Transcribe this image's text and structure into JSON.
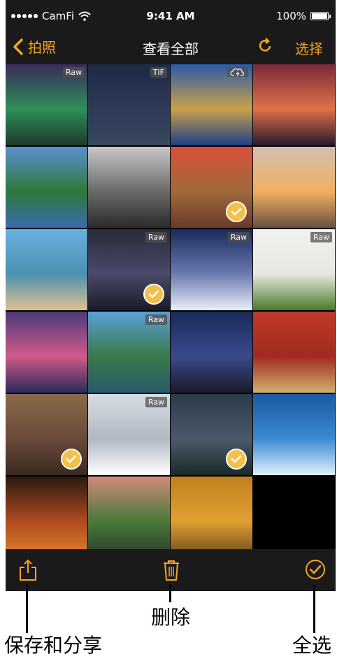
{
  "status_bar": {
    "carrier": "CamFi",
    "time": "9:41 AM",
    "battery": "100%"
  },
  "nav": {
    "back_label": "拍照",
    "title": "查看全部",
    "select_label": "选择"
  },
  "grid": {
    "tiles": [
      {
        "badge": "Raw",
        "check": false,
        "cloud": false,
        "colors": [
          "#3b2a5a",
          "#2f8f5a",
          "#1c3b2a"
        ]
      },
      {
        "badge": "TIF",
        "check": false,
        "cloud": false,
        "colors": [
          "#1e2a44",
          "#2e3a58",
          "#39475f"
        ]
      },
      {
        "badge": "",
        "check": false,
        "cloud": true,
        "colors": [
          "#2b5aa8",
          "#c9a04a",
          "#1d3f86"
        ]
      },
      {
        "badge": "",
        "check": false,
        "cloud": false,
        "colors": [
          "#7a2a3a",
          "#e0704a",
          "#2a1a2a"
        ]
      },
      {
        "badge": "",
        "check": false,
        "cloud": false,
        "colors": [
          "#5b8fd0",
          "#2e7a3a",
          "#3a6ab0"
        ]
      },
      {
        "badge": "",
        "check": false,
        "cloud": false,
        "colors": [
          "#c8c8c8",
          "#6a6a6a",
          "#2a2a2a"
        ]
      },
      {
        "badge": "",
        "check": true,
        "cloud": false,
        "colors": [
          "#d9503a",
          "#a06a3a",
          "#6a3a2a"
        ]
      },
      {
        "badge": "",
        "check": false,
        "cloud": false,
        "colors": [
          "#d0c0b0",
          "#f0b060",
          "#6a5040"
        ]
      },
      {
        "badge": "",
        "check": false,
        "cloud": false,
        "colors": [
          "#6ab0e0",
          "#4a90b0",
          "#e0c090"
        ]
      },
      {
        "badge": "Raw",
        "check": true,
        "cloud": false,
        "colors": [
          "#2a2a3a",
          "#4a4a6a",
          "#1a1a2a"
        ]
      },
      {
        "badge": "Raw",
        "check": false,
        "cloud": false,
        "colors": [
          "#1a2a5a",
          "#6a7ab0",
          "#e8eef8"
        ]
      },
      {
        "badge": "Raw",
        "check": false,
        "cloud": false,
        "colors": [
          "#f0f0f0",
          "#e8e8e0",
          "#4a7a2a"
        ]
      },
      {
        "badge": "",
        "check": false,
        "cloud": false,
        "colors": [
          "#4a3a7a",
          "#d05a8a",
          "#2a2a5a"
        ]
      },
      {
        "badge": "Raw",
        "check": false,
        "cloud": false,
        "colors": [
          "#5aa0d8",
          "#3a7a4a",
          "#2a5a6a"
        ]
      },
      {
        "badge": "",
        "check": false,
        "cloud": false,
        "colors": [
          "#1a2a5a",
          "#3a4a8a",
          "#1a1a2a"
        ]
      },
      {
        "badge": "",
        "check": false,
        "cloud": false,
        "colors": [
          "#c03a2a",
          "#a02a20",
          "#d0b070"
        ]
      },
      {
        "badge": "",
        "check": true,
        "cloud": false,
        "colors": [
          "#8a6a4a",
          "#6a4a3a",
          "#3a2a20"
        ]
      },
      {
        "badge": "Raw",
        "check": false,
        "cloud": false,
        "colors": [
          "#d8dde4",
          "#b0b8c4",
          "#ffffff"
        ]
      },
      {
        "badge": "",
        "check": true,
        "cloud": false,
        "colors": [
          "#2a3a4a",
          "#4a5a6a",
          "#1a2a2a"
        ]
      },
      {
        "badge": "",
        "check": false,
        "cloud": false,
        "colors": [
          "#1a5aa0",
          "#3a8ad0",
          "#e0f0ff"
        ]
      },
      {
        "badge": "",
        "check": false,
        "cloud": false,
        "colors": [
          "#2a1a10",
          "#b04a20",
          "#e08030"
        ]
      },
      {
        "badge": "",
        "check": false,
        "cloud": false,
        "colors": [
          "#d08a7a",
          "#4a7a3a",
          "#2a3a2a"
        ]
      },
      {
        "badge": "",
        "check": false,
        "cloud": false,
        "colors": [
          "#c08020",
          "#e0a030",
          "#6a4a20"
        ]
      }
    ]
  },
  "annotations": {
    "delete": "删除",
    "share": "保存和分享",
    "select_all": "全选"
  }
}
